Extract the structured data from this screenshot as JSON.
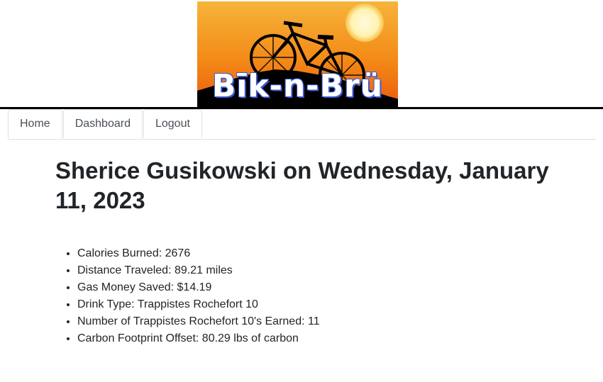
{
  "header": {
    "brand": "Bīk-n-Brü",
    "colors": {
      "sky_top": "#f4a51e",
      "sky_bottom": "#f06b10",
      "sun": "#fff7c8",
      "silhouette": "#000000",
      "brand_outline": "#3b5bd6"
    }
  },
  "tabs": [
    {
      "label": "Home"
    },
    {
      "label": "Dashboard"
    },
    {
      "label": "Logout"
    }
  ],
  "main": {
    "title": "Sherice Gusikowski on Wednesday, January 11, 2023",
    "stats": [
      "Calories Burned: 2676",
      "Distance Traveled: 89.21 miles",
      "Gas Money Saved: $14.19",
      "Drink Type: Trappistes Rochefort 10",
      "Number of Trappistes Rochefort 10's Earned: 11",
      "Carbon Footprint Offset: 80.29 lbs of carbon"
    ]
  }
}
